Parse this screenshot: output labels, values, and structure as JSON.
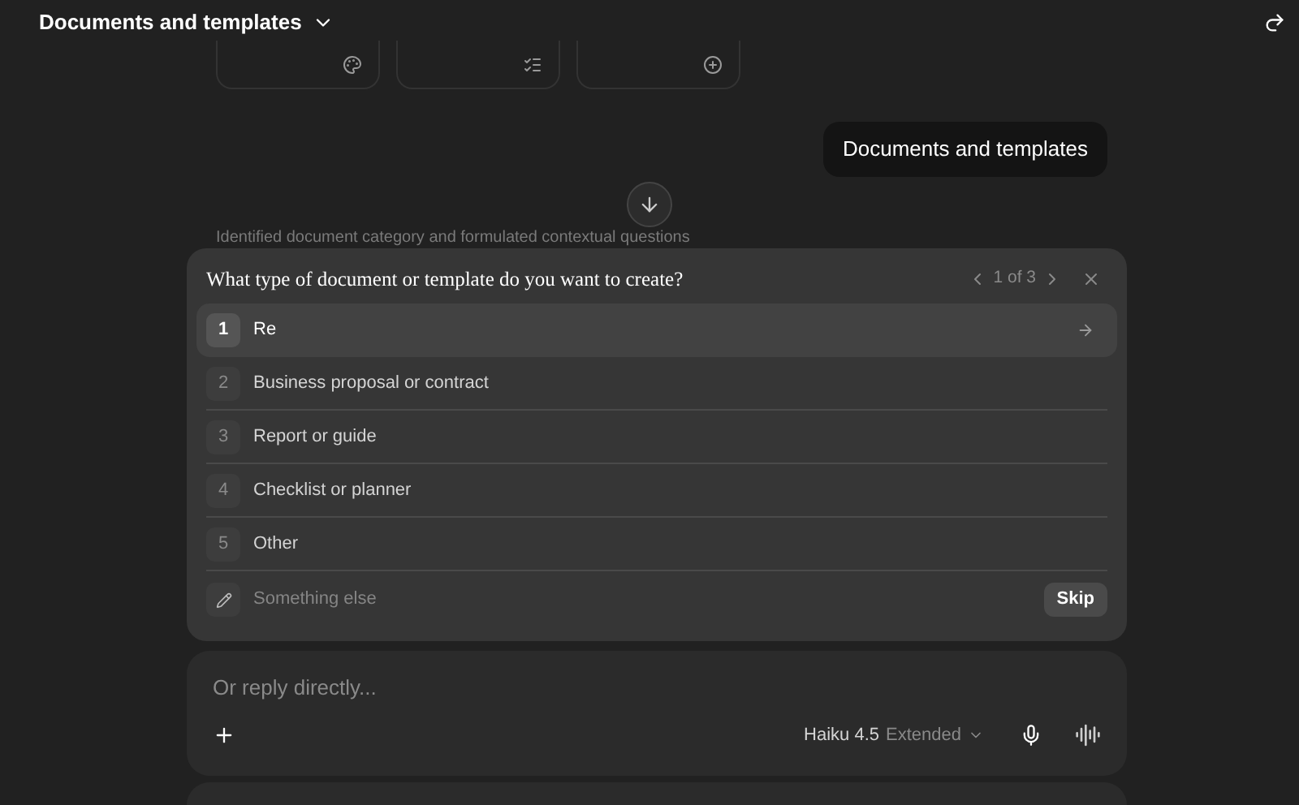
{
  "header": {
    "title": "Documents and templates"
  },
  "user_message": "Documents and templates",
  "status_text": "Identified document category and formulated contextual questions",
  "question": {
    "title": "What type of document or template do you want to create?",
    "pager": "1 of 3",
    "options": [
      {
        "number": "1",
        "label": "Re",
        "selected": true
      },
      {
        "number": "2",
        "label": "Business proposal or contract",
        "selected": false
      },
      {
        "number": "3",
        "label": "Report or guide",
        "selected": false
      },
      {
        "number": "4",
        "label": "Checklist or planner",
        "selected": false
      },
      {
        "number": "5",
        "label": "Other",
        "selected": false
      }
    ],
    "other_placeholder": "Something else",
    "skip": "Skip"
  },
  "composer": {
    "placeholder": "Or reply directly...",
    "model": "Haiku 4.5",
    "mode": "Extended"
  }
}
